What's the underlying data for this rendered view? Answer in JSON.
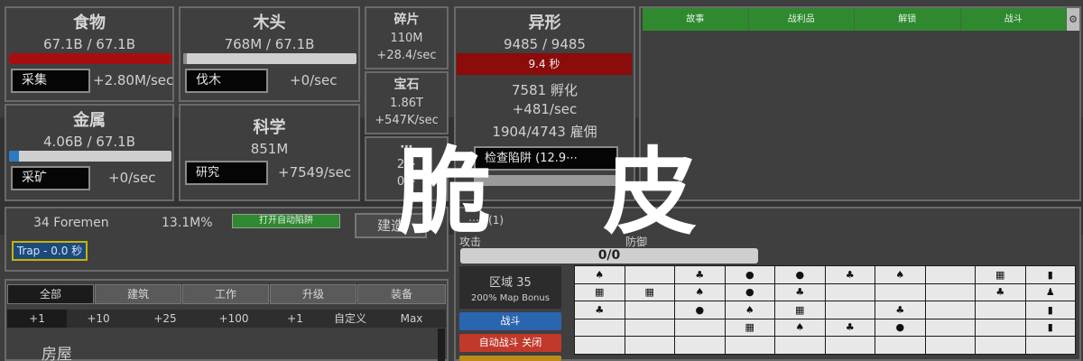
{
  "food": {
    "title": "食物",
    "amount": "67.1B / 67.1B",
    "fill": 1.0,
    "button": "采集",
    "rate": "+2.80M/sec",
    "color": "#a50f0f"
  },
  "wood": {
    "title": "木头",
    "amount": "768M / 67.1B",
    "fill": 0.02,
    "button": "伐木",
    "rate": "+0/sec"
  },
  "metal": {
    "title": "金属",
    "amount": "4.06B / 67.1B",
    "fill": 0.06,
    "button": "采矿",
    "rate": "+0/sec",
    "color": "#2a7bbf"
  },
  "science": {
    "title": "科学",
    "amount": "851M",
    "button": "研究",
    "rate": "+7549/sec"
  },
  "fragments": {
    "title": "碎片",
    "amount": "110M",
    "rate": "+28.4/sec"
  },
  "gems": {
    "title": "宝石",
    "amount": "1.86T",
    "rate": "+547K/sec"
  },
  "third_small": {
    "title": "⋯",
    "line1": "2⋯",
    "line2": "0⋯"
  },
  "aliens": {
    "title": "异形",
    "amount": "9485 / 9485",
    "timer": "9.4 秒",
    "breeding": "7581 孵化",
    "rate": "+481/sec",
    "employed": "1904/4743 雇佣",
    "trap_check": "检查陷阱 (12.9⋯"
  },
  "top_tabs": [
    "故事",
    "战利品",
    "解锁",
    "战斗"
  ],
  "gear_icon": "⚙",
  "foremen": {
    "text": "34 Foremen",
    "percent": "13.1M%",
    "auto_trap": "打开自动陷阱",
    "build": "建造",
    "trap": "Trap - 0.0 秒"
  },
  "battle": {
    "header": "⋯s (1)",
    "attack_label": "攻击",
    "defense_label": "防御",
    "progress": "0/0",
    "zone": "区域 35",
    "bonus": "200% Map Bonus",
    "fight": "战斗",
    "auto_fight": "自动战斗 关闭"
  },
  "build_tabs": [
    "全部",
    "建筑",
    "工作",
    "升级",
    "装备"
  ],
  "quantities": [
    "+1",
    "+10",
    "+25",
    "+100",
    "+1",
    "自定义",
    "Max"
  ],
  "section": {
    "title": "房屋"
  },
  "map_grid": [
    [
      "♠",
      "",
      "♣",
      "●",
      "●",
      "♣",
      "♠",
      "",
      "▦",
      "▮"
    ],
    [
      "▦",
      "▦",
      "♠",
      "●",
      "♣",
      "",
      "",
      "",
      "♣",
      "♟"
    ],
    [
      "♣",
      "",
      "●",
      "♠",
      "▦",
      "",
      "♣",
      "",
      "",
      "▮"
    ],
    [
      "",
      "",
      "",
      "▦",
      "♠",
      "♣",
      "●",
      "",
      "",
      "▮"
    ],
    [
      "",
      "",
      "",
      "",
      "",
      "",
      "",
      "",
      "",
      ""
    ]
  ],
  "overlay": "脆 皮"
}
